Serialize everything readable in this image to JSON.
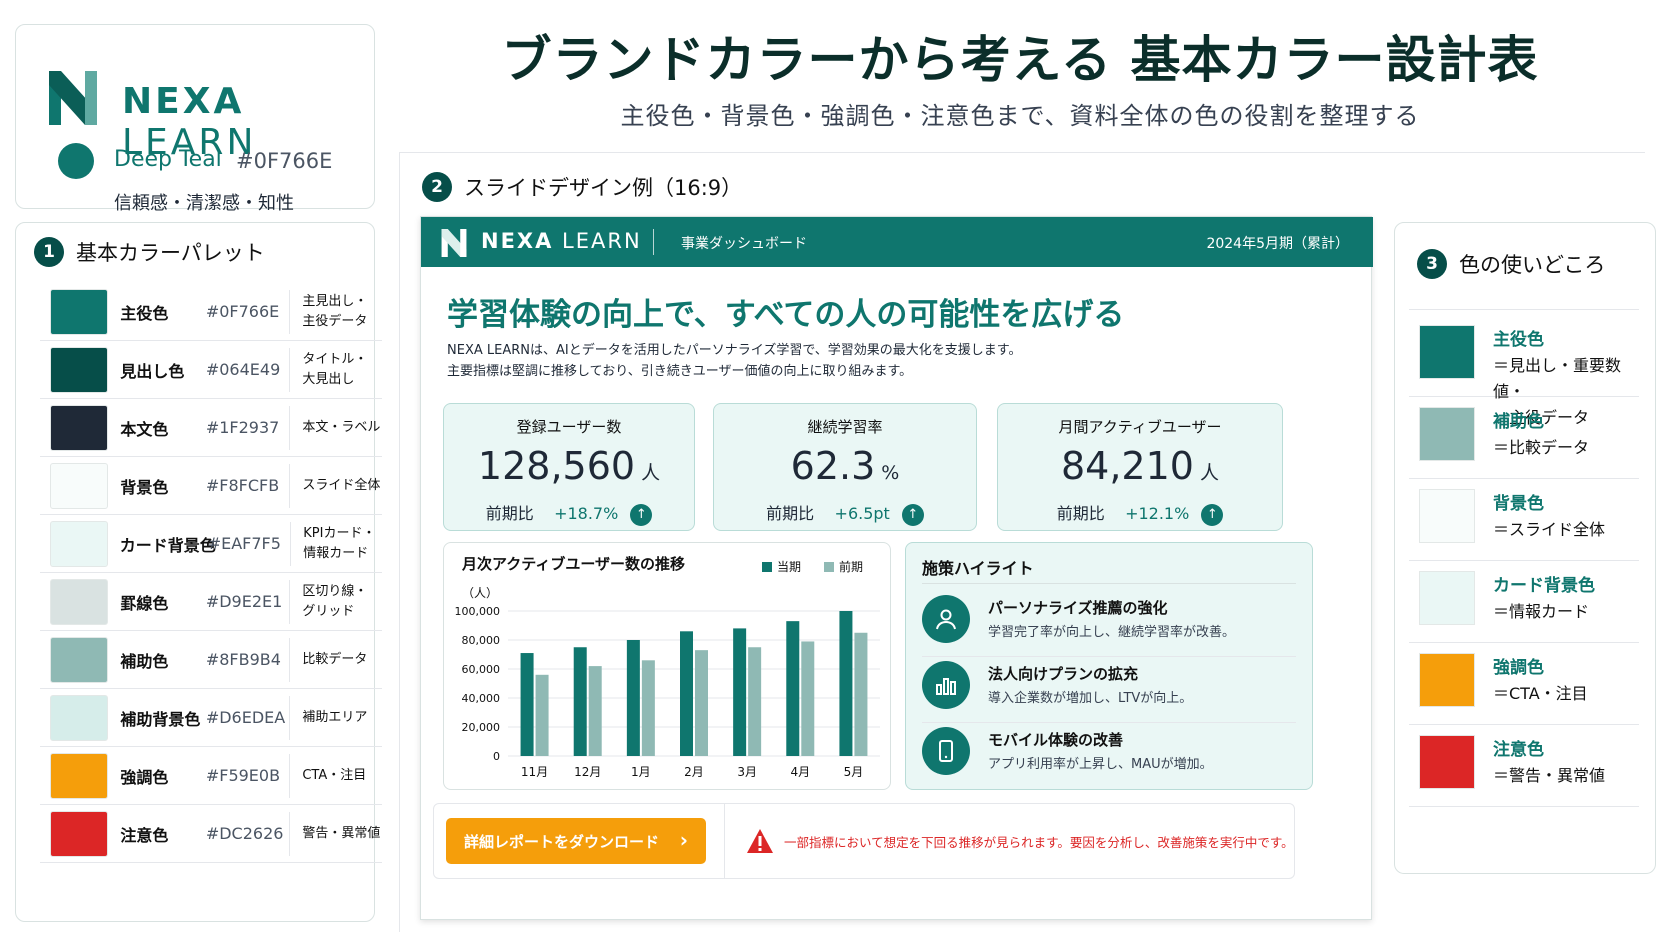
{
  "brand": {
    "name_bold": "NEXA",
    "name_light": " LEARN",
    "color_name": "Deep Teal",
    "hex": "#0F766E",
    "desc": "信頼感・清潔感・知性"
  },
  "header": {
    "title": "ブランドカラーから考える 基本カラー設計表",
    "subtitle": "主役色・背景色・強調色・注意色まで、資料全体の色の役割を整理する"
  },
  "palette": {
    "num": "1",
    "title": "基本カラーパレット",
    "rows": [
      {
        "name": "主役色",
        "hex": "#0F766E",
        "use": "主見出し・\n主役データ",
        "color": "#0F766E"
      },
      {
        "name": "見出し色",
        "hex": "#064E49",
        "use": "タイトル・\n大見出し",
        "color": "#064E49"
      },
      {
        "name": "本文色",
        "hex": "#1F2937",
        "use": "本文・ラベル",
        "color": "#1F2937"
      },
      {
        "name": "背景色",
        "hex": "#F8FCFB",
        "use": "スライド全体",
        "color": "#F8FCFB"
      },
      {
        "name": "カード背景色",
        "hex": "#EAF7F5",
        "use": "KPIカード・\n情報カード",
        "color": "#EAF7F5"
      },
      {
        "name": "罫線色",
        "hex": "#D9E2E1",
        "use": "区切り線・\nグリッド",
        "color": "#D9E2E1"
      },
      {
        "name": "補助色",
        "hex": "#8FB9B4",
        "use": "比較データ",
        "color": "#8FB9B4"
      },
      {
        "name": "補助背景色",
        "hex": "#D6EDEA",
        "use": "補助エリア",
        "color": "#D6EDEA"
      },
      {
        "name": "強調色",
        "hex": "#F59E0B",
        "use": "CTA・注目",
        "color": "#F59E0B"
      },
      {
        "name": "注意色",
        "hex": "#DC2626",
        "use": "警告・異常値",
        "color": "#DC2626"
      }
    ]
  },
  "slide_section": {
    "num": "2",
    "title": "スライドデザイン例（16:9）"
  },
  "slide": {
    "brand_bold": "NEXA",
    "brand_light": " LEARN",
    "dashboard": "事業ダッシュボード",
    "period": "2024年5月期（累計）",
    "headline": "学習体験の向上で、すべての人の可能性を広げる",
    "body1": "NEXA LEARNは、AIとデータを活用したパーソナライズ学習で、学習効果の最大化を支援します。",
    "body2": "主要指標は堅調に推移しており、引き続きユーザー価値の向上に取り組みます。",
    "kpis": [
      {
        "label": "登録ユーザー数",
        "value": "128,560",
        "unit": "人",
        "delta_label": "前期比",
        "delta": "+18.7%"
      },
      {
        "label": "継続学習率",
        "value": "62.3",
        "unit": "%",
        "delta_label": "前期比",
        "delta": "+6.5pt"
      },
      {
        "label": "月間アクティブユーザー",
        "value": "84,210",
        "unit": "人",
        "delta_label": "前期比",
        "delta": "+12.1%"
      }
    ],
    "highlights_title": "施策ハイライト",
    "highlights": [
      {
        "icon": "user-icon",
        "title": "パーソナライズ推薦の強化",
        "desc": "学習完了率が向上し、継続学習率が改善。"
      },
      {
        "icon": "bar-chart-icon",
        "title": "法人向けプランの拡充",
        "desc": "導入企業数が増加し、LTVが向上。"
      },
      {
        "icon": "mobile-icon",
        "title": "モバイル体験の改善",
        "desc": "アプリ利用率が上昇し、MAUが増加。"
      }
    ],
    "cta": "詳細レポートをダウンロード",
    "alert": "一部指標において想定を下回る推移が見られます。要因を分析し、改善施策を実行中です。"
  },
  "chart_data": {
    "type": "bar",
    "title": "月次アクティブユーザー数の推移",
    "ylabel": "（人）",
    "categories": [
      "11月",
      "12月",
      "1月",
      "2月",
      "3月",
      "4月",
      "5月"
    ],
    "series": [
      {
        "name": "当期",
        "values": [
          71000,
          75000,
          80000,
          86000,
          88000,
          93000,
          100000
        ],
        "color": "#0F766E"
      },
      {
        "name": "前期",
        "values": [
          56000,
          62000,
          66000,
          73000,
          75000,
          79000,
          85000
        ],
        "color": "#8FB9B4"
      }
    ],
    "ylim": [
      0,
      100000
    ],
    "yticks": [
      "100,000",
      "80,000",
      "60,000",
      "40,000",
      "20,000",
      "0"
    ],
    "grid": true,
    "legend": "top-right"
  },
  "usage": {
    "num": "3",
    "title": "色の使いどころ",
    "rows": [
      {
        "name": "主役色",
        "desc": "＝見出し・重要数値・\n　主役データ",
        "color": "#0F766E"
      },
      {
        "name": "補助色",
        "desc": "＝比較データ",
        "color": "#8FB9B4"
      },
      {
        "name": "背景色",
        "desc": "＝スライド全体",
        "color": "#F8FCFB"
      },
      {
        "name": "カード背景色",
        "desc": "＝情報カード",
        "color": "#EAF7F5"
      },
      {
        "name": "強調色",
        "desc": "＝CTA・注目",
        "color": "#F59E0B"
      },
      {
        "name": "注意色",
        "desc": "＝警告・異常値",
        "color": "#DC2626"
      }
    ]
  }
}
